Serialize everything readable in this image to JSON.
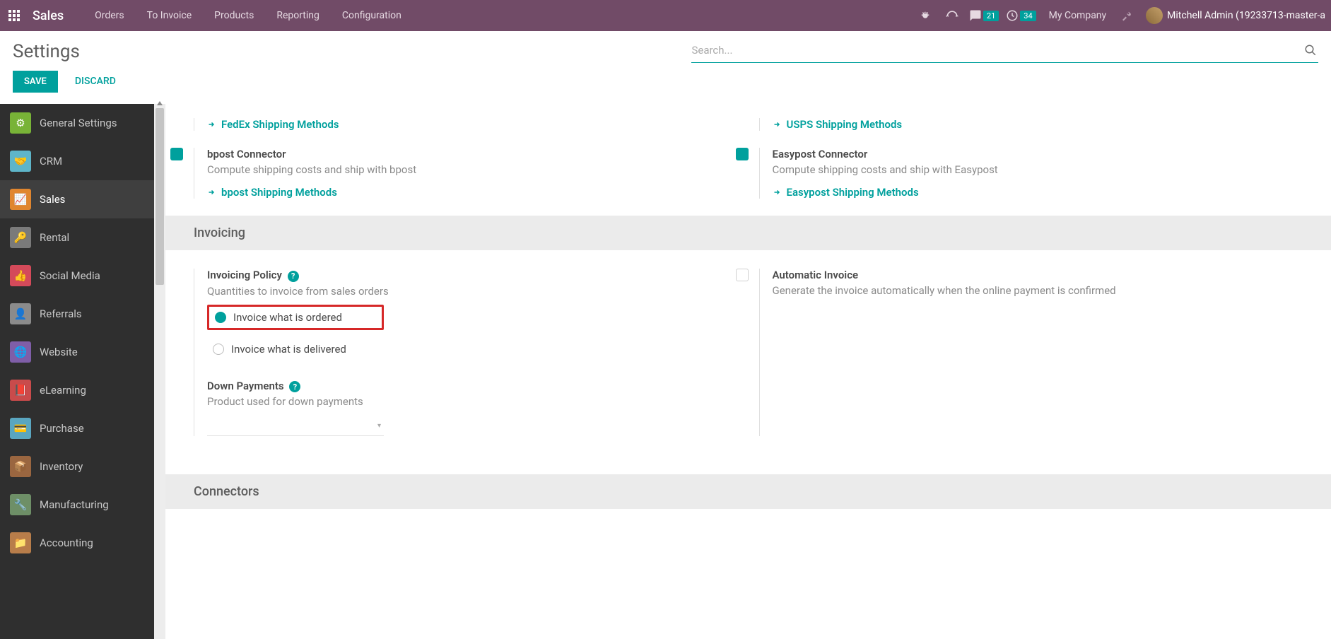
{
  "nav": {
    "brand": "Sales",
    "links": [
      "Orders",
      "To Invoice",
      "Products",
      "Reporting",
      "Configuration"
    ],
    "msg_count": "21",
    "clock_count": "34",
    "company": "My Company",
    "user": "Mitchell Admin (19233713-master-a"
  },
  "header": {
    "title": "Settings",
    "search_placeholder": "Search...",
    "save": "SAVE",
    "discard": "DISCARD"
  },
  "sidebar": {
    "items": [
      {
        "label": "General Settings"
      },
      {
        "label": "CRM"
      },
      {
        "label": "Sales"
      },
      {
        "label": "Rental"
      },
      {
        "label": "Social Media"
      },
      {
        "label": "Referrals"
      },
      {
        "label": "Website"
      },
      {
        "label": "eLearning"
      },
      {
        "label": "Purchase"
      },
      {
        "label": "Inventory"
      },
      {
        "label": "Manufacturing"
      },
      {
        "label": "Accounting"
      }
    ]
  },
  "main": {
    "fedex_link": "FedEx Shipping Methods",
    "usps_link": "USPS Shipping Methods",
    "bpost_title": "bpost Connector",
    "bpost_desc": "Compute shipping costs and ship with bpost",
    "bpost_link": "bpost Shipping Methods",
    "easy_title": "Easypost Connector",
    "easy_desc": "Compute shipping costs and ship with Easypost",
    "easy_link": "Easypost Shipping Methods",
    "invoicing_header": "Invoicing",
    "inv_policy_title": "Invoicing Policy",
    "inv_policy_desc": "Quantities to invoice from sales orders",
    "radio_ordered": "Invoice what is ordered",
    "radio_delivered": "Invoice what is delivered",
    "auto_inv_title": "Automatic Invoice",
    "auto_inv_desc": "Generate the invoice automatically when the online payment is confirmed",
    "dp_title": "Down Payments",
    "dp_desc": "Product used for down payments",
    "connectors_header": "Connectors"
  }
}
